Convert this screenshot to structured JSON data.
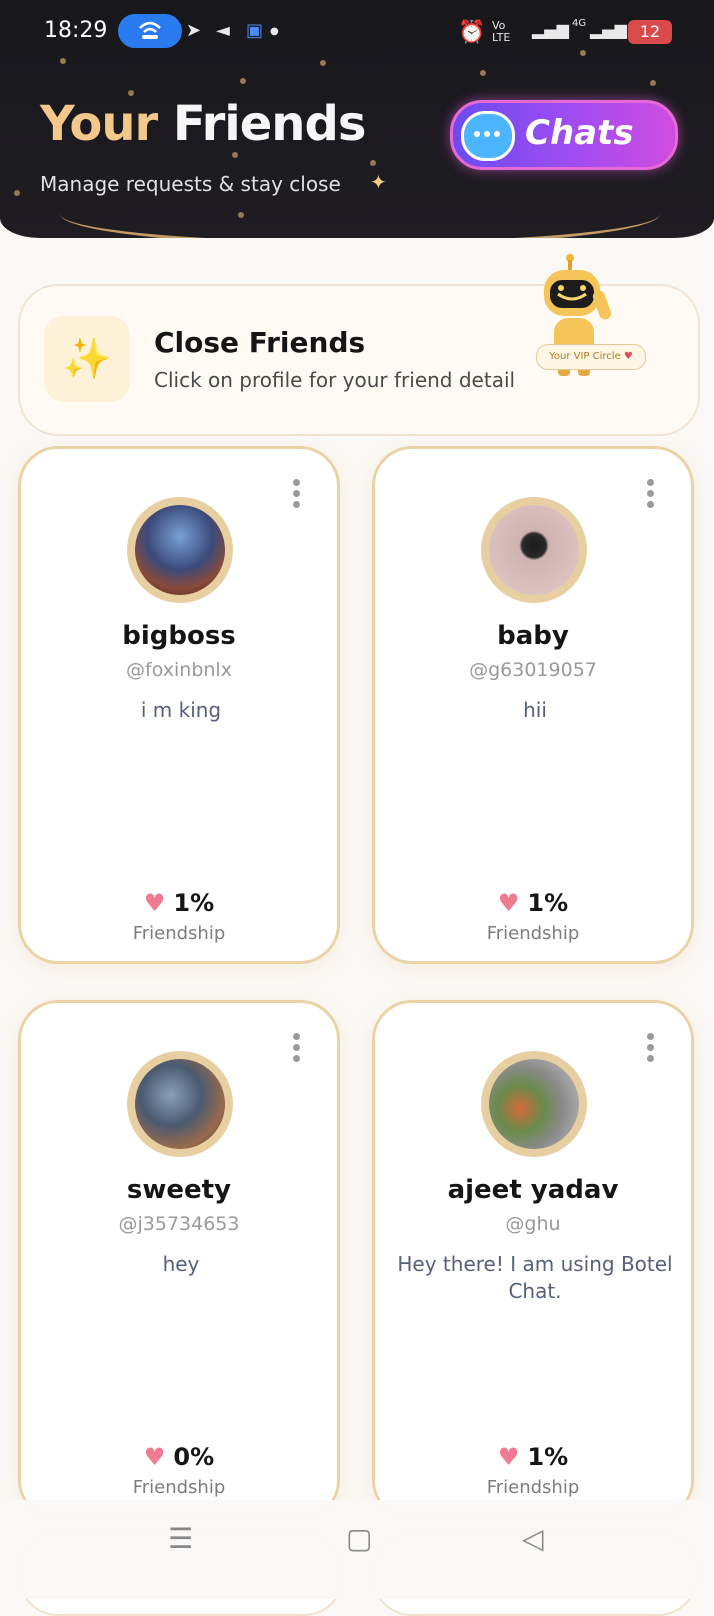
{
  "status_bar": {
    "time": "18:29",
    "net_label_top": "Vo",
    "net_label_bottom": "LTE",
    "signal_label": "4G",
    "battery": "12"
  },
  "header": {
    "title_part1": "Your",
    "title_part2": "Friends",
    "subtitle": "Manage requests & stay close",
    "chats_label": "Chats"
  },
  "close_friends": {
    "title": "Close Friends",
    "subtitle": "Click on profile for your friend detail",
    "vip_label": "Your VIP Circle"
  },
  "friends": [
    {
      "name": "bigboss",
      "handle": "@foxinbnlx",
      "bio": "i m king",
      "friendship_pct": "1%",
      "friendship_label": "Friendship"
    },
    {
      "name": "baby",
      "handle": "@g63019057",
      "bio": "hii",
      "friendship_pct": "1%",
      "friendship_label": "Friendship"
    },
    {
      "name": "sweety",
      "handle": "@j35734653",
      "bio": "hey",
      "friendship_pct": "0%",
      "friendship_label": "Friendship"
    },
    {
      "name": "ajeet yadav",
      "handle": "@ghu",
      "bio": "Hey there! I am using Botel Chat.",
      "friendship_pct": "1%",
      "friendship_label": "Friendship"
    }
  ],
  "colors": {
    "header_bg": "#17171c",
    "accent_gold": "#f2c98b",
    "chats_gradient_start": "#6a4cf0",
    "chats_gradient_end": "#d14ce0",
    "heart": "#f17a93"
  }
}
